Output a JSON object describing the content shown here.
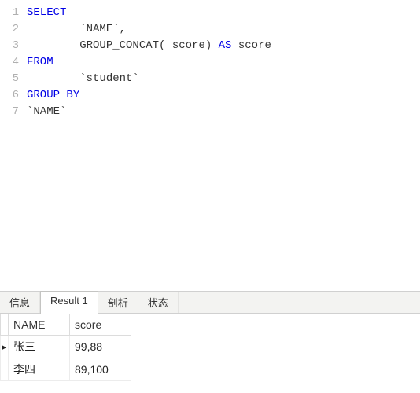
{
  "editor": {
    "lines": [
      {
        "n": "1",
        "tokens": [
          {
            "cls": "kw",
            "t": "SELECT"
          }
        ]
      },
      {
        "n": "2",
        "tokens": [
          {
            "cls": "plain",
            "t": "\t`NAME`,"
          }
        ]
      },
      {
        "n": "3",
        "tokens": [
          {
            "cls": "plain",
            "t": "\tGROUP_CONCAT( score) "
          },
          {
            "cls": "kw",
            "t": "AS"
          },
          {
            "cls": "plain",
            "t": " score "
          }
        ]
      },
      {
        "n": "4",
        "tokens": [
          {
            "cls": "kw",
            "t": "FROM"
          }
        ]
      },
      {
        "n": "5",
        "tokens": [
          {
            "cls": "plain",
            "t": "\t`student` "
          }
        ]
      },
      {
        "n": "6",
        "tokens": [
          {
            "cls": "kw",
            "t": "GROUP"
          },
          {
            "cls": "plain",
            "t": " "
          },
          {
            "cls": "kw",
            "t": "BY"
          }
        ]
      },
      {
        "n": "7",
        "tokens": [
          {
            "cls": "plain",
            "t": "`NAME`"
          }
        ]
      }
    ]
  },
  "tabs": {
    "items": [
      "信息",
      "Result 1",
      "剖析",
      "状态"
    ],
    "active": 1
  },
  "result": {
    "columns": [
      "NAME",
      "score"
    ],
    "rows": [
      {
        "marker": "▸",
        "cells": [
          "张三",
          "99,88"
        ]
      },
      {
        "marker": "",
        "cells": [
          "李四",
          "89,100"
        ]
      }
    ]
  }
}
